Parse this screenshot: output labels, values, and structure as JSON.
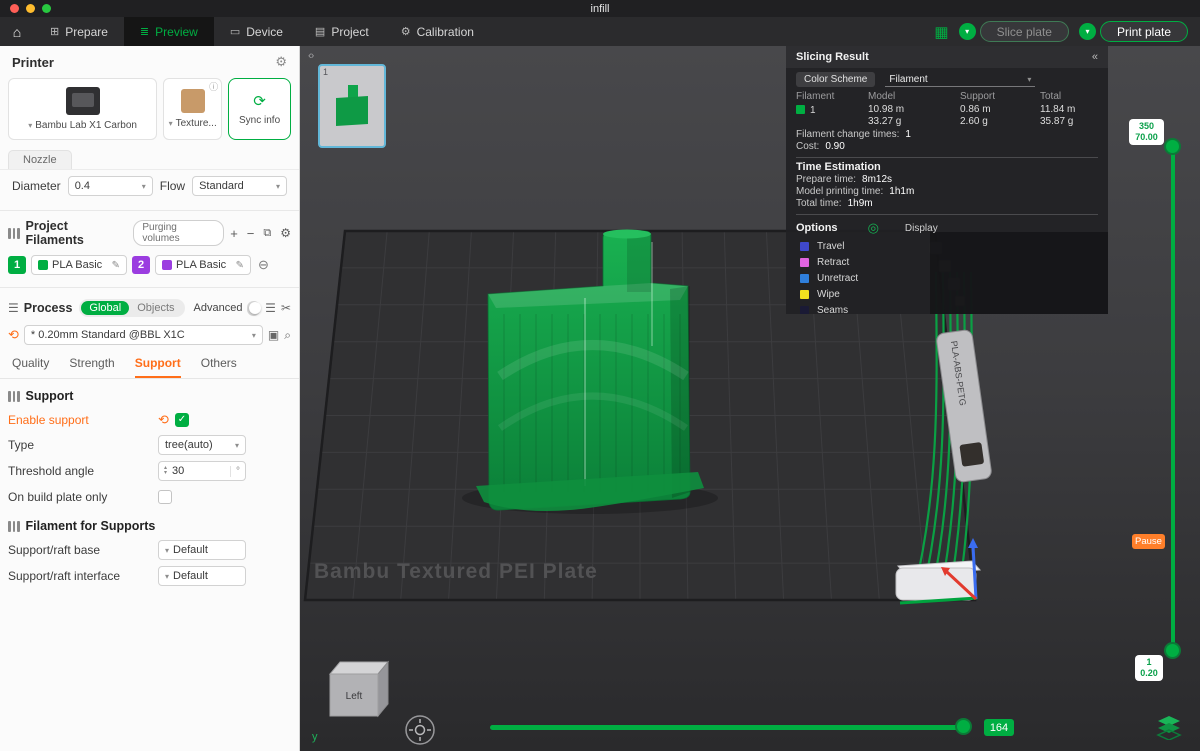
{
  "icons": {
    "home": "⌂",
    "prepare": "⊞",
    "preview": "≣",
    "device": "▭",
    "project": "▤",
    "calibration": "⚙",
    "plates": "▦",
    "gear": "⚙",
    "info": "ⓘ",
    "sync": "⟳",
    "caret": "▾",
    "plus": "+",
    "minus": "−",
    "copy": "⧉",
    "list": "☰",
    "scissors": "✂",
    "refresh": "⟲",
    "edit": "✎",
    "flush": "⊖",
    "search": "⌕",
    "save": "▣",
    "check": "✓",
    "spin_up": "▴",
    "spin_down": "▾",
    "collapse": "«",
    "expand": "‹›",
    "chevron": "▾",
    "spool": "◎"
  },
  "titlebar": {
    "title": "infill"
  },
  "nav": {
    "tabs": [
      {
        "label": "Prepare"
      },
      {
        "label": "Preview"
      },
      {
        "label": "Device"
      },
      {
        "label": "Project"
      },
      {
        "label": "Calibration"
      }
    ],
    "slice_label": "Slice plate",
    "print_label": "Print plate"
  },
  "sidebar": {
    "printer": {
      "title": "Printer",
      "device_name": "Bambu Lab X1 Carbon",
      "plate_type": "Texture...",
      "sync_label": "Sync info",
      "nozzle_tab": "Nozzle",
      "diameter_label": "Diameter",
      "diameter_value": "0.4",
      "flow_label": "Flow",
      "flow_value": "Standard"
    },
    "filaments": {
      "title": "Project Filaments",
      "purging_label": "Purging volumes",
      "items": [
        {
          "index": "1",
          "name": "PLA Basic",
          "color": "#00AE42"
        },
        {
          "index": "2",
          "name": "PLA Basic",
          "color": "#9B3DE0"
        }
      ]
    },
    "process": {
      "title": "Process",
      "scope_global": "Global",
      "scope_objects": "Objects",
      "advanced_label": "Advanced",
      "preset": "* 0.20mm Standard @BBL X1C",
      "tabs": [
        {
          "label": "Quality"
        },
        {
          "label": "Strength"
        },
        {
          "label": "Support"
        },
        {
          "label": "Others"
        }
      ]
    },
    "support": {
      "section_title": "Support",
      "enable_label": "Enable support",
      "type_label": "Type",
      "type_value": "tree(auto)",
      "threshold_label": "Threshold angle",
      "threshold_value": "30",
      "threshold_unit": "°",
      "on_plate_label": "On build plate only",
      "filament_section_title": "Filament for Supports",
      "base_label": "Support/raft base",
      "base_value": "Default",
      "interface_label": "Support/raft interface",
      "interface_value": "Default"
    }
  },
  "slicing_result": {
    "title": "Slicing Result",
    "color_scheme_label": "Color Scheme",
    "color_scheme_value": "Filament",
    "table": {
      "headers": [
        "Filament",
        "Model",
        "Support",
        "Total"
      ],
      "rows": [
        {
          "filament": "1",
          "color": "#00AE42",
          "model_len": "10.98 m",
          "model_wt": "33.27 g",
          "support_len": "0.86 m",
          "support_wt": "2.60 g",
          "total_len": "11.84 m",
          "total_wt": "35.87 g"
        }
      ]
    },
    "change_label": "Filament change times:",
    "change_value": "1",
    "cost_label": "Cost:",
    "cost_value": "0.90",
    "time_title": "Time Estimation",
    "times": [
      {
        "label": "Prepare time:",
        "value": "8m12s"
      },
      {
        "label": "Model printing time:",
        "value": "1h1m"
      },
      {
        "label": "Total time:",
        "value": "1h9m"
      }
    ],
    "options_title": "Options",
    "display_label": "Display",
    "legend": [
      {
        "label": "Travel",
        "color": "#3F48CC"
      },
      {
        "label": "Retract",
        "color": "#E063E0"
      },
      {
        "label": "Unretract",
        "color": "#2F7FDC"
      },
      {
        "label": "Wipe",
        "color": "#F0E11F"
      },
      {
        "label": "Seams",
        "color": "#1A1A35"
      }
    ]
  },
  "viewport": {
    "plate_label": "Bambu Textured PEI Plate",
    "thumb_index": "1",
    "cube_label": "Left",
    "axis_y_label": "y",
    "spool_text": "PLA-ABS-PETG",
    "progress_value": "164",
    "layer_top_line1": "350",
    "layer_top_line2": "70.00",
    "pause_label": "Pause",
    "layer_bottom_line1": "1",
    "layer_bottom_line2": "0.20"
  }
}
